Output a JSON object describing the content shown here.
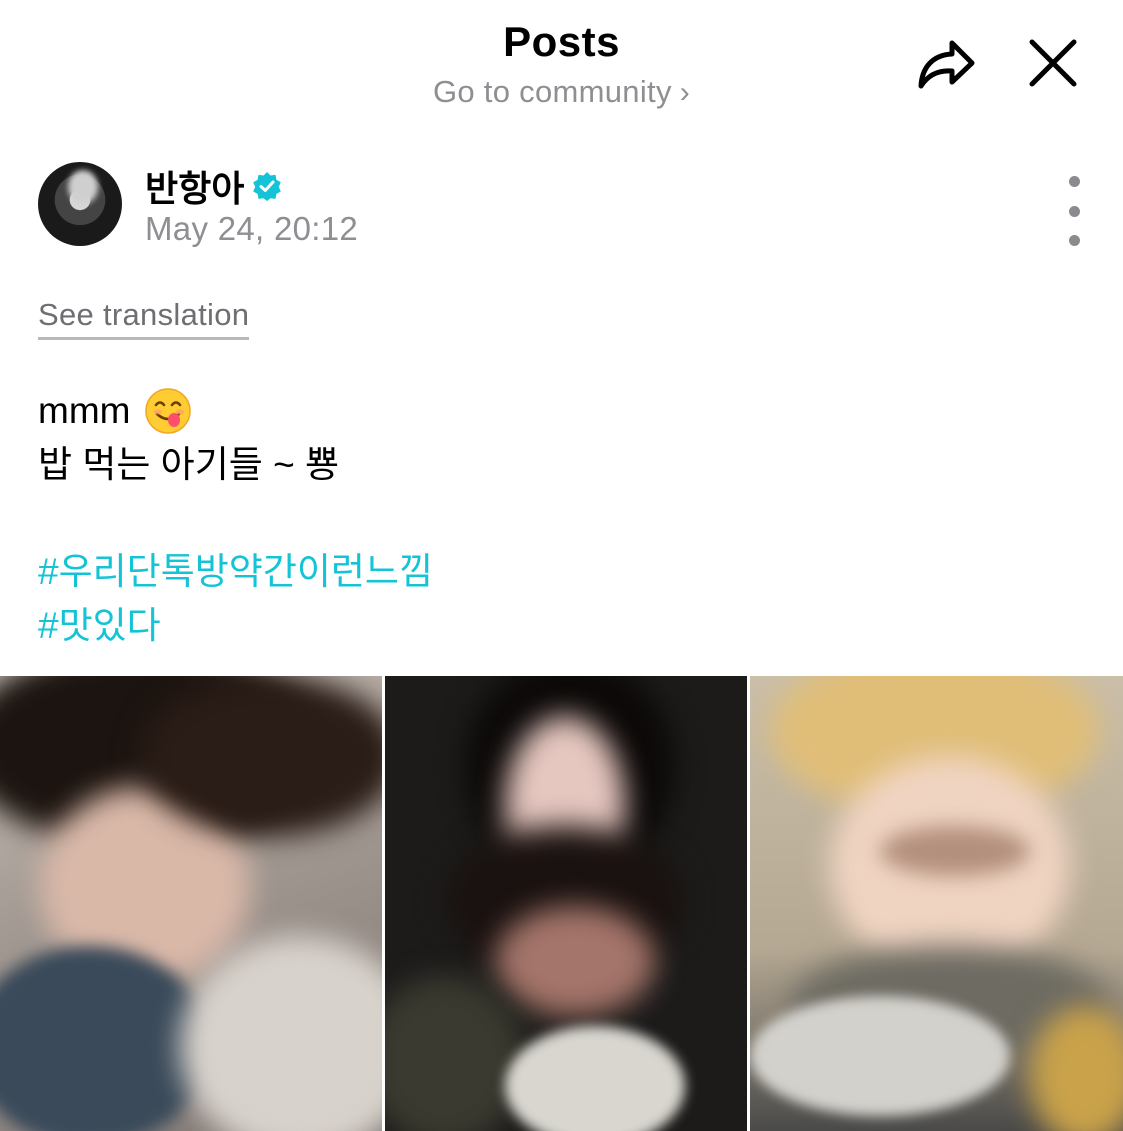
{
  "header": {
    "title": "Posts",
    "subtitle": "Go to community",
    "subtitle_chevron": "›",
    "share_icon": "share-arrow-icon",
    "close_icon": "close-icon"
  },
  "post": {
    "author": "반항아",
    "verified": true,
    "time": "May 24, 20:12",
    "see_translation": "See translation",
    "lines": [
      "mmm",
      "밥 먹는 아기들 ~ 뿅"
    ],
    "emoji": "😋",
    "hashtags": [
      "#우리단톡방약간이런느낌",
      "#맛있다"
    ],
    "photo_count": 3
  },
  "colors": {
    "hashtag": "#14c4d6",
    "verified_badge": "#15c3d6",
    "secondary_text": "#8e8e93"
  }
}
